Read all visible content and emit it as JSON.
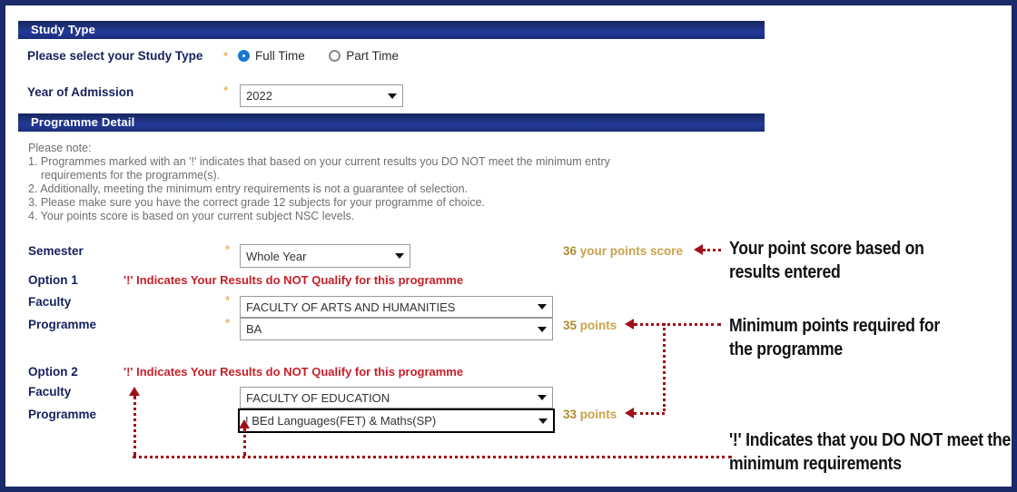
{
  "sections": {
    "study_type": {
      "title": "Study Type"
    },
    "programme_detail": {
      "title": "Programme Detail"
    }
  },
  "study_type": {
    "label": "Please select your Study Type",
    "required_marker": "*",
    "options": [
      {
        "label": "Full Time",
        "selected": true
      },
      {
        "label": "Part Time",
        "selected": false
      }
    ],
    "year_label": "Year of Admission",
    "year_value": "2022"
  },
  "note": {
    "heading": "Please note:",
    "lines": [
      "1. Programmes marked with an '!' indicates that based on your current results you DO NOT meet the minimum entry",
      "    requirements for the programme(s).",
      "2. Additionally, meeting the minimum entry requirements is not a guarantee of selection.",
      "3. Please make sure you have the correct grade 12 subjects for your programme of choice.",
      "4. Your points score is based on your current subject NSC levels."
    ]
  },
  "form": {
    "semester_label": "Semester",
    "semester_value": "Whole Year",
    "option1_label": "Option 1",
    "option1_warning": "'!' Indicates Your Results do NOT Qualify for this programme",
    "option1_faculty_label": "Faculty",
    "option1_faculty_value": "FACULTY OF ARTS AND HUMANITIES",
    "option1_programme_label": "Programme",
    "option1_programme_value": "BA",
    "option2_label": "Option 2",
    "option2_warning": "'!' Indicates Your Results do NOT Qualify for this programme",
    "option2_faculty_label": "Faculty",
    "option2_faculty_value": "FACULTY OF EDUCATION",
    "option2_programme_label": "Programme",
    "option2_programme_value": "! BEd Languages(FET) & Maths(SP)"
  },
  "points": {
    "your_score_num": "36",
    "your_score_text": " your points score",
    "option1_num": "35",
    "option1_text": " points",
    "option2_num": "33",
    "option2_text": " points"
  },
  "annotations": {
    "score": "Your point score based on\nresults entered",
    "minimum": "Minimum points required for\nthe programme",
    "exclaim": "'!' Indicates that you DO NOT meet the\nminimum requirements"
  },
  "colors": {
    "header_blue": "#1f3585",
    "frame_navy": "#1b2a6b",
    "label_navy": "#15225c",
    "warning_red": "#c6202a",
    "connector_red": "#a01018",
    "points_gold": "#c9a24a",
    "required_orange": "#f0b26b",
    "radio_blue": "#1976d2"
  }
}
